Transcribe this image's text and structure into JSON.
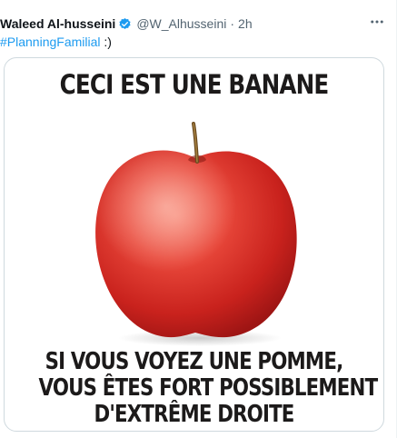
{
  "tweet": {
    "display_name": "Waleed Al-husseini",
    "handle": "@W_Alhusseini",
    "separator": "·",
    "time": "2h",
    "more_icon": "more-icon",
    "hashtag": "#PlanningFamilial",
    "text_after": " :)"
  },
  "media": {
    "top_text": "CECI EST UNE BANANE",
    "bottom_lines": [
      "SI VOUS VOYEZ UNE POMME,",
      "VOUS ÊTES FORT POSSIBLEMENT",
      "D'EXTRÊME DROITE"
    ],
    "image": "apple-image"
  },
  "colors": {
    "link": "#1d9bf0",
    "verified": "#1d9bf0",
    "muted": "#536471",
    "text": "#0f1419"
  }
}
